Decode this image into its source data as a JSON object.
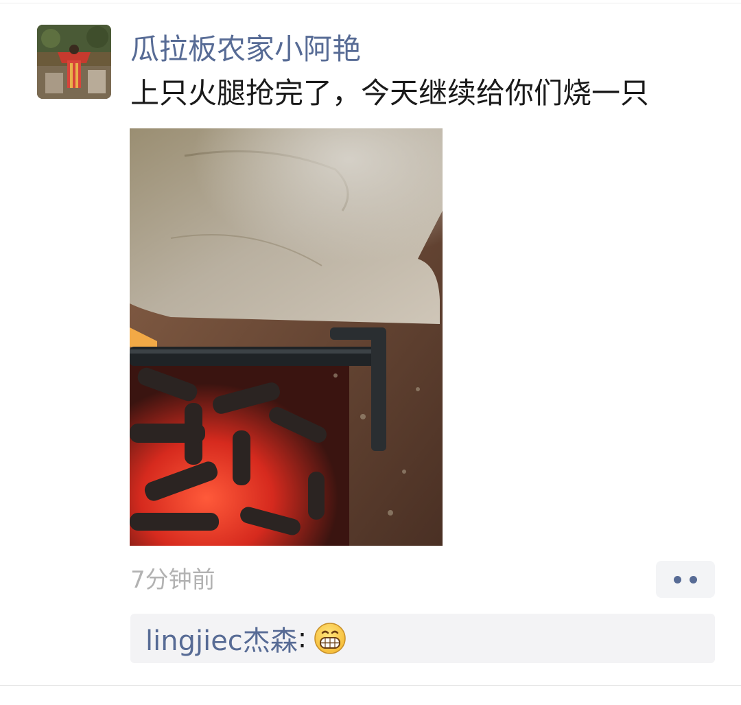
{
  "post": {
    "author": "瓜拉板农家小阿艳",
    "text": "上只火腿抢完了，今天继续给你们烧一只",
    "timestamp": "7分钟前",
    "avatar_icon": "user-avatar",
    "photo_subject": "ham-roasting-over-corncob-fire",
    "more_icon": "more-dots-icon"
  },
  "comments": [
    {
      "name": "lingjiec杰森",
      "separator": ":",
      "emoji": "grinning-face-emoji"
    }
  ],
  "colors": {
    "link": "#576b95",
    "text": "#1a1a1a",
    "muted": "#b2b2b2",
    "comment_bg": "#f3f3f5"
  }
}
